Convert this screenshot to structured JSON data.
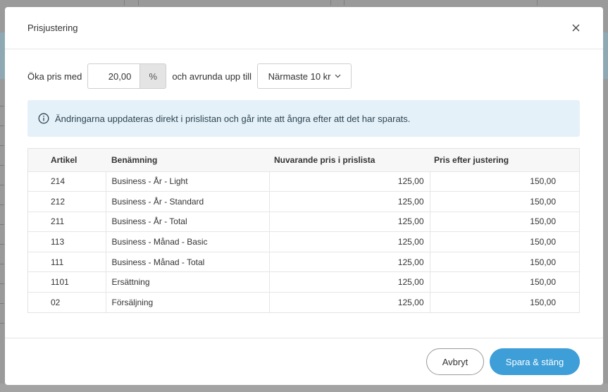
{
  "modal": {
    "title": "Prisjustering",
    "close_icon": "close-icon"
  },
  "controls": {
    "increase_label": "Öka pris med",
    "percent_value": "20,00",
    "percent_unit": "%",
    "round_label": "och avrunda upp till",
    "round_selected": "Närmaste 10 kr",
    "round_icon": "chevron-down-icon"
  },
  "info": {
    "icon": "info-icon",
    "text": "Ändringarna uppdateras direkt i prislistan och går inte att ångra efter att det har sparats."
  },
  "table": {
    "headers": [
      "Artikel",
      "Benämning",
      "Nuvarande pris i prislista",
      "Pris efter justering"
    ],
    "rows": [
      {
        "article": "214",
        "name": "Business - År - Light",
        "current": "125,00",
        "new": "150,00"
      },
      {
        "article": "212",
        "name": "Business - År - Standard",
        "current": "125,00",
        "new": "150,00"
      },
      {
        "article": "211",
        "name": "Business - År - Total",
        "current": "125,00",
        "new": "150,00"
      },
      {
        "article": "113",
        "name": "Business - Månad - Basic",
        "current": "125,00",
        "new": "150,00"
      },
      {
        "article": "111",
        "name": "Business - Månad - Total",
        "current": "125,00",
        "new": "150,00"
      },
      {
        "article": "1101",
        "name": "Ersättning",
        "current": "125,00",
        "new": "150,00"
      },
      {
        "article": "02",
        "name": "Försäljning",
        "current": "125,00",
        "new": "150,00"
      }
    ]
  },
  "footer": {
    "cancel_label": "Avbryt",
    "save_label": "Spara & stäng"
  },
  "colors": {
    "accent": "#3d9ed8",
    "info_bg": "#e5f1f8",
    "overlay": "#8f8f8f"
  }
}
